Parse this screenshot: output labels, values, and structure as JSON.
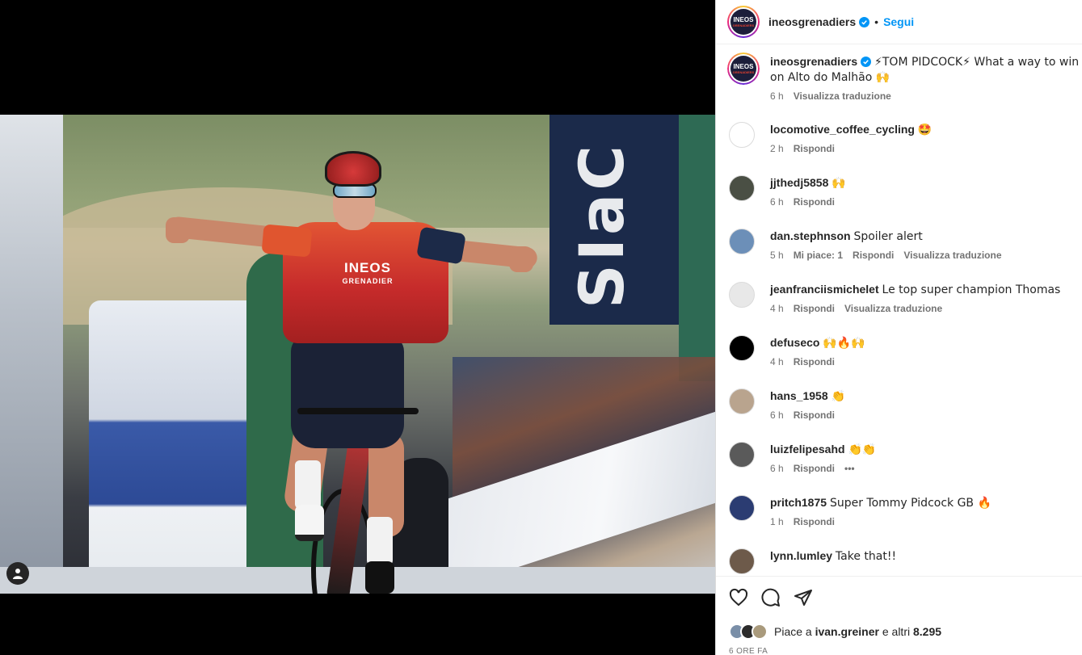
{
  "post": {
    "username": "ineosgrenadiers",
    "follow_label": "Segui",
    "dot": "•",
    "avatar_text": "INEOS",
    "avatar_sub": "GRENADIERS",
    "caption_prefix": "⚡TOM PIDCOCK⚡ What a way to win on Alto do Malhão 🙌",
    "caption_time": "6 h",
    "caption_translate": "Visualizza traduzione",
    "jersey_text": "INEOS",
    "jersey_sub": "GRENADIER",
    "banner_text": "SIaC"
  },
  "comments": [
    {
      "user": "locomotive_coffee_cycling",
      "text": "🤩",
      "time": "2 h",
      "reply": "Rispondi",
      "likes": "",
      "translate": "",
      "avatar_color": "#ffffff"
    },
    {
      "user": "jjthedj5858",
      "text": "🙌",
      "time": "6 h",
      "reply": "Rispondi",
      "likes": "",
      "translate": "",
      "avatar_color": "#4a4f44"
    },
    {
      "user": "dan.stephnson",
      "text": "Spoiler alert",
      "time": "5 h",
      "reply": "Rispondi",
      "likes": "Mi piace: 1",
      "translate": "Visualizza traduzione",
      "avatar_color": "#6c8fb8"
    },
    {
      "user": "jeanfranciismichelet",
      "text": "Le top super champion Thomas",
      "time": "4 h",
      "reply": "Rispondi",
      "likes": "",
      "translate": "Visualizza traduzione",
      "avatar_color": "#e8e8e8"
    },
    {
      "user": "defuseco",
      "text": "🙌🔥🙌",
      "time": "4 h",
      "reply": "Rispondi",
      "likes": "",
      "translate": "",
      "avatar_color": "#000000"
    },
    {
      "user": "hans_1958",
      "text": "👏",
      "time": "6 h",
      "reply": "Rispondi",
      "likes": "",
      "translate": "",
      "avatar_color": "#b9a48e"
    },
    {
      "user": "luizfelipesahd",
      "text": "👏👏",
      "time": "6 h",
      "reply": "Rispondi",
      "likes": "",
      "translate": "",
      "more": "•••",
      "avatar_color": "#5a5a5a"
    },
    {
      "user": "pritch1875",
      "text": "Super Tommy Pidcock GB 🔥",
      "time": "1 h",
      "reply": "Rispondi",
      "likes": "",
      "translate": "",
      "avatar_color": "#2b3c72"
    },
    {
      "user": "lynn.lumley",
      "text": "Take that!!",
      "time": "",
      "reply": "",
      "likes": "",
      "translate": "",
      "avatar_color": "#6d5a4a"
    }
  ],
  "footer": {
    "likes_prefix": "Piace a",
    "likes_user": "ivan.greiner",
    "likes_mid": "e altri",
    "likes_count": "8.295",
    "time": "6 ORE FA"
  }
}
